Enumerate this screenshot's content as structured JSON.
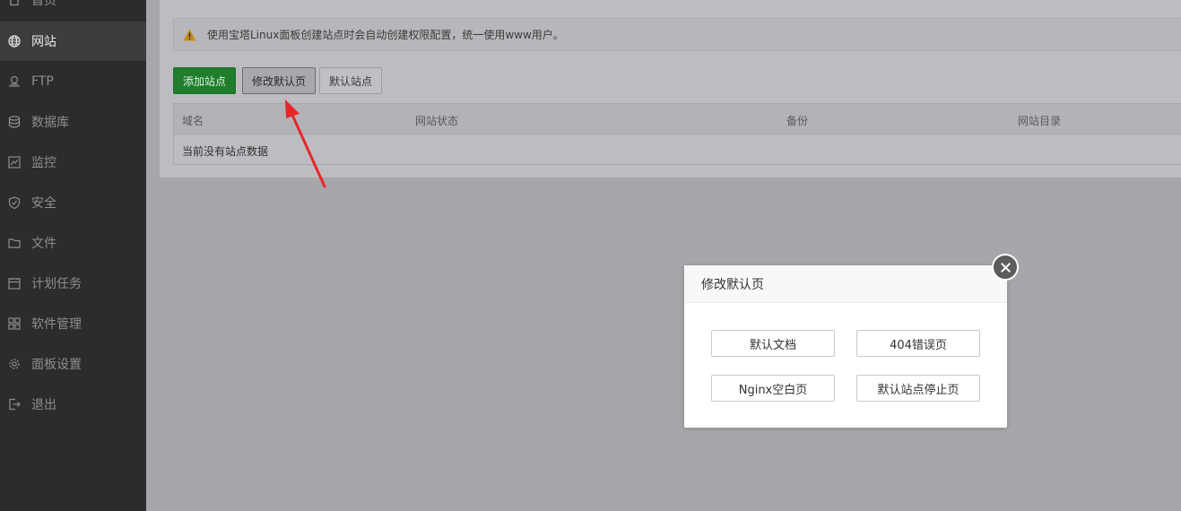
{
  "sidebar": {
    "items": [
      {
        "label": "首页",
        "icon": "home-icon"
      },
      {
        "label": "网站",
        "icon": "globe-icon",
        "active": true
      },
      {
        "label": "FTP",
        "icon": "ftp-icon"
      },
      {
        "label": "数据库",
        "icon": "database-icon"
      },
      {
        "label": "监控",
        "icon": "monitor-icon"
      },
      {
        "label": "安全",
        "icon": "shield-icon"
      },
      {
        "label": "文件",
        "icon": "folder-icon"
      },
      {
        "label": "计划任务",
        "icon": "calendar-icon"
      },
      {
        "label": "软件管理",
        "icon": "apps-icon"
      },
      {
        "label": "面板设置",
        "icon": "gear-icon"
      },
      {
        "label": "退出",
        "icon": "logout-icon"
      }
    ]
  },
  "main": {
    "notice": "使用宝塔Linux面板创建站点时会自动创建权限配置，统一使用www用户。",
    "toolbar": {
      "add_site": "添加站点",
      "modify_default_page": "修改默认页",
      "default_site": "默认站点"
    },
    "table": {
      "headers": [
        "域名",
        "网站状态",
        "备份",
        "网站目录"
      ],
      "empty_text": "当前没有站点数据"
    }
  },
  "modal": {
    "title": "修改默认页",
    "buttons": [
      "默认文档",
      "404错误页",
      "Nginx空白页",
      "默认站点停止页"
    ]
  },
  "colors": {
    "sidebar_bg": "#2c2c2c",
    "accent_green": "#1f7d2c",
    "arrow_red": "#e8262a",
    "warning": "#c88a14"
  }
}
